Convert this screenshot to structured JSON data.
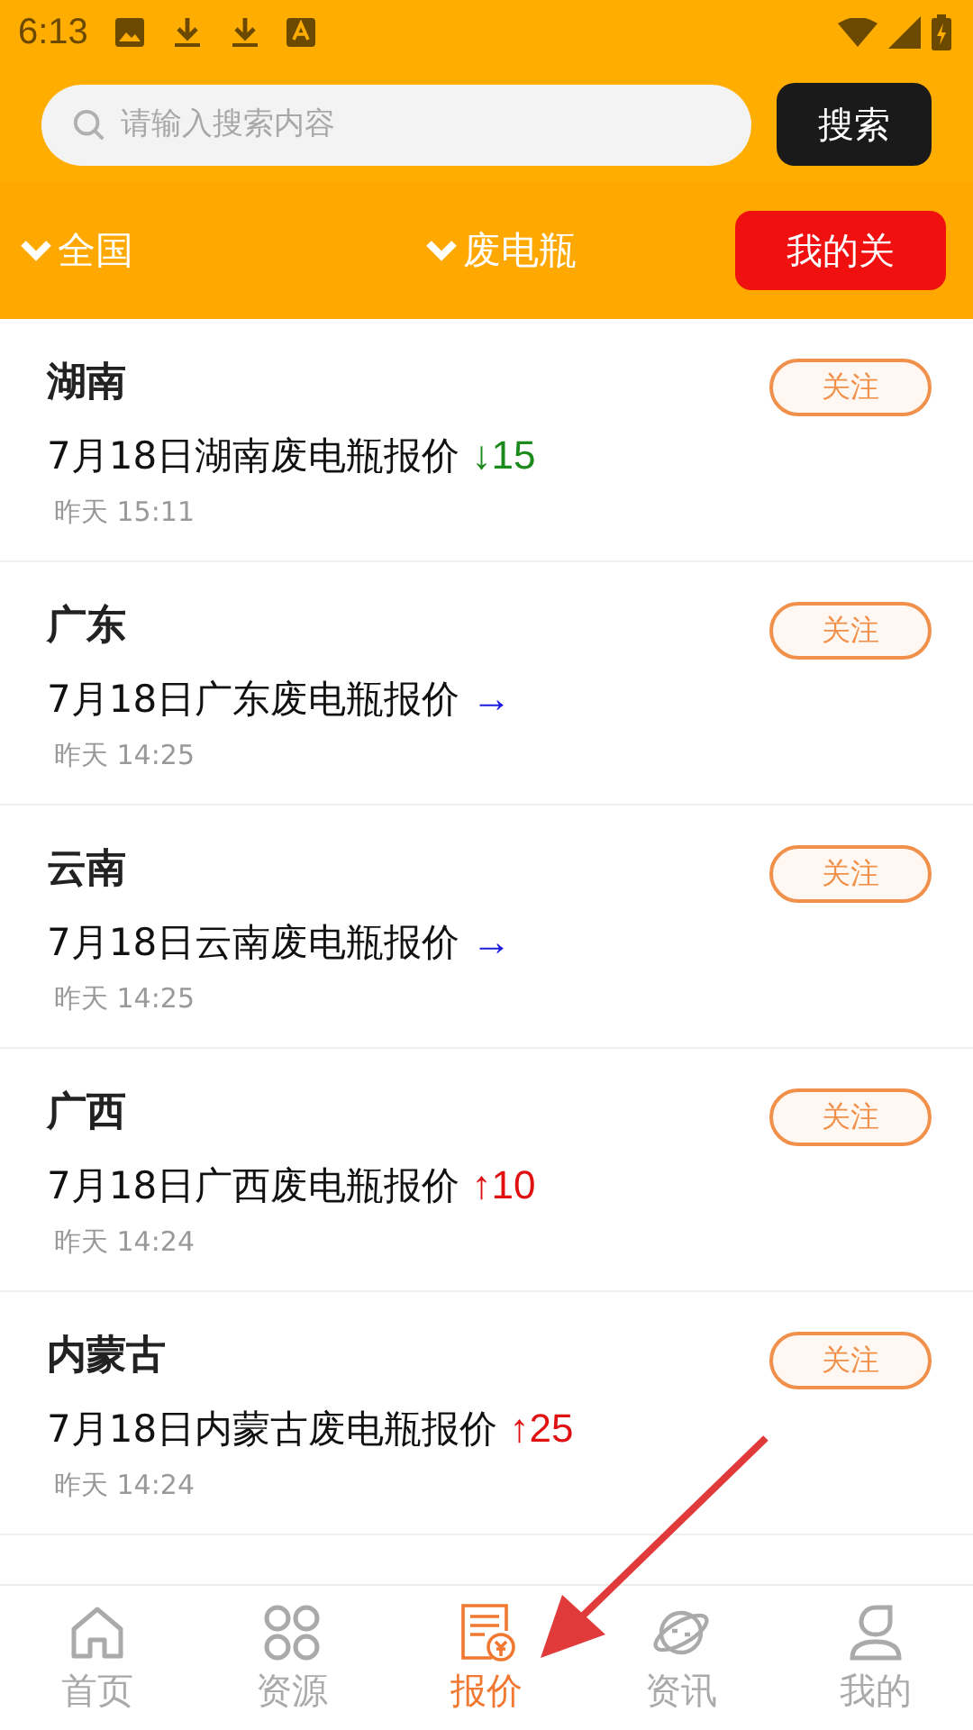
{
  "status_bar": {
    "time": "6:13"
  },
  "search": {
    "placeholder": "请输入搜索内容",
    "button": "搜索"
  },
  "filters": [
    {
      "label": "全国"
    },
    {
      "label": "废电瓶"
    }
  ],
  "my_follow_button": "我的关",
  "items": [
    {
      "region": "湖南",
      "title": "7月18日湖南废电瓶报价",
      "kind": "down",
      "arrow": "↓",
      "change": "15",
      "time": "昨天 15:11",
      "follow": "关注"
    },
    {
      "region": "广东",
      "title": "7月18日广东废电瓶报价",
      "kind": "flat",
      "arrow": "→",
      "time": "昨天 14:25",
      "follow": "关注"
    },
    {
      "region": "云南",
      "title": "7月18日云南废电瓶报价",
      "kind": "flat",
      "arrow": "→",
      "time": "昨天 14:25",
      "follow": "关注"
    },
    {
      "region": "广西",
      "title": "7月18日广西废电瓶报价",
      "kind": "up",
      "arrow": "↑",
      "change": "10",
      "time": "昨天 14:24",
      "follow": "关注"
    },
    {
      "region": "内蒙古",
      "title": "7月18日内蒙古废电瓶报价",
      "kind": "up",
      "arrow": "↑",
      "change": "25",
      "time": "昨天 14:24",
      "follow": "关注"
    }
  ],
  "tabs": [
    {
      "label": "首页",
      "kind": "home",
      "selected": false
    },
    {
      "label": "资源",
      "kind": "grid",
      "selected": false
    },
    {
      "label": "报价",
      "kind": "quote",
      "selected": true
    },
    {
      "label": "资讯",
      "kind": "planet",
      "selected": false
    },
    {
      "label": "我的",
      "kind": "person",
      "selected": false
    }
  ]
}
